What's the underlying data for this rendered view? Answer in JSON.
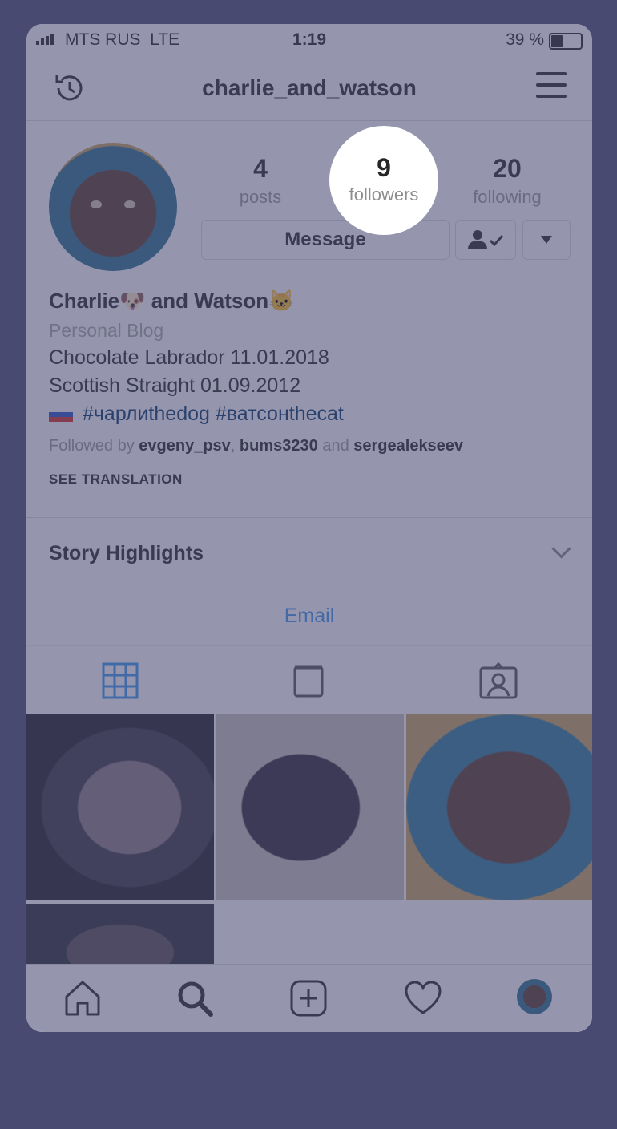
{
  "status_bar": {
    "carrier": "MTS RUS",
    "network": "LTE",
    "time": "1:19",
    "battery": "39 %"
  },
  "header": {
    "username": "charlie_and_watson"
  },
  "stats": {
    "posts": {
      "value": "4",
      "label": "posts"
    },
    "followers": {
      "value": "9",
      "label": "followers"
    },
    "following": {
      "value": "20",
      "label": "following"
    }
  },
  "actions": {
    "message_label": "Message"
  },
  "bio": {
    "name": "Charlie🐶 and Watson🐱",
    "category": "Personal Blog",
    "line1": "Chocolate Labrador 11.01.2018",
    "line2": "Scottish Straight 01.09.2012",
    "hashtags": "#чарлиthedog #ватсонthecat",
    "followed_prefix": "Followed by",
    "followed_user1": "evgeny_psv",
    "followed_user2": "bums3230",
    "followed_and": "and",
    "followed_user3": "sergealekseev",
    "see_translation": "SEE TRANSLATION"
  },
  "highlights": {
    "title": "Story Highlights"
  },
  "contact": {
    "email_label": "Email"
  },
  "colors": {
    "accent": "#3897f0",
    "overlay": "#484a72"
  }
}
